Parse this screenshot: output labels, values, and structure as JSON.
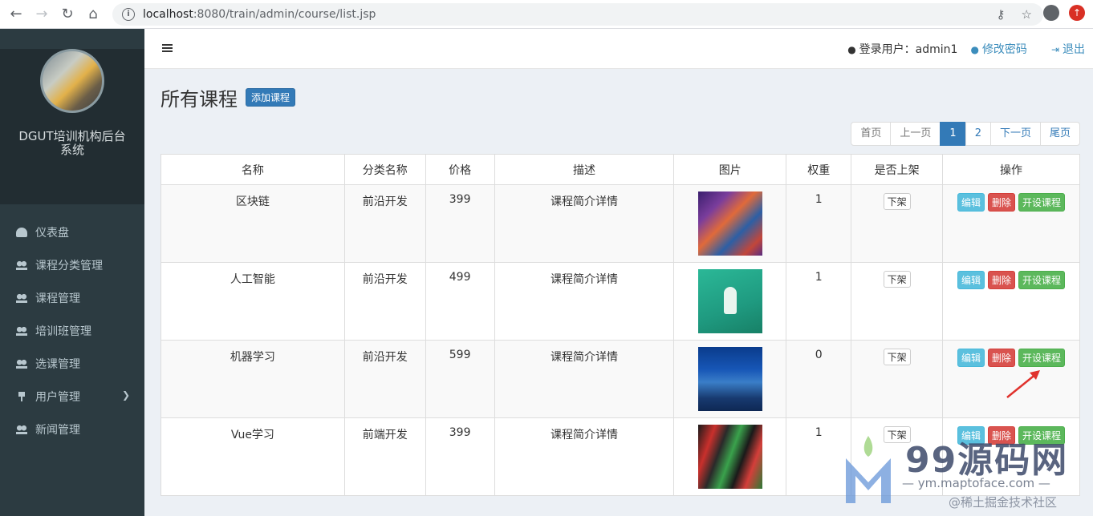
{
  "browser": {
    "url_host": "localhost",
    "url_path": ":8080/train/admin/course/list.jsp"
  },
  "sidebar": {
    "site_title": "DGUT培训机构后台系统",
    "items": [
      {
        "label": "仪表盘",
        "icon": "dashboard-icon"
      },
      {
        "label": "课程分类管理",
        "icon": "users-icon"
      },
      {
        "label": "课程管理",
        "icon": "users-icon"
      },
      {
        "label": "培训班管理",
        "icon": "users-icon"
      },
      {
        "label": "选课管理",
        "icon": "users-icon"
      },
      {
        "label": "用户管理",
        "icon": "pin-icon"
      },
      {
        "label": "新闻管理",
        "icon": "users-icon"
      }
    ]
  },
  "topbar": {
    "user_text": "登录用户：admin1",
    "change_password": "修改密码",
    "logout": "退出"
  },
  "page": {
    "title": "所有课程",
    "add_button": "添加课程"
  },
  "pager": {
    "first": "首页",
    "prev": "上一页",
    "pages": [
      "1",
      "2"
    ],
    "next": "下一页",
    "last": "尾页"
  },
  "table": {
    "headers": [
      "名称",
      "分类名称",
      "价格",
      "描述",
      "图片",
      "权重",
      "是否上架",
      "操作"
    ],
    "rows": [
      {
        "name": "区块链",
        "category": "前沿开发",
        "price": "399",
        "desc": "课程简介详情",
        "weight": "1",
        "status_btn": "下架"
      },
      {
        "name": "人工智能",
        "category": "前沿开发",
        "price": "499",
        "desc": "课程简介详情",
        "weight": "1",
        "status_btn": "下架"
      },
      {
        "name": "机器学习",
        "category": "前沿开发",
        "price": "599",
        "desc": "课程简介详情",
        "weight": "0",
        "status_btn": "下架"
      },
      {
        "name": "Vue学习",
        "category": "前端开发",
        "price": "399",
        "desc": "课程简介详情",
        "weight": "1",
        "status_btn": "下架"
      }
    ],
    "actions": {
      "edit": "编辑",
      "delete": "删除",
      "open": "开设课程"
    }
  },
  "watermark": {
    "big": "99源码网",
    "url": "— ym.maptoface.com —",
    "sub": "@稀土掘金技术社区"
  }
}
